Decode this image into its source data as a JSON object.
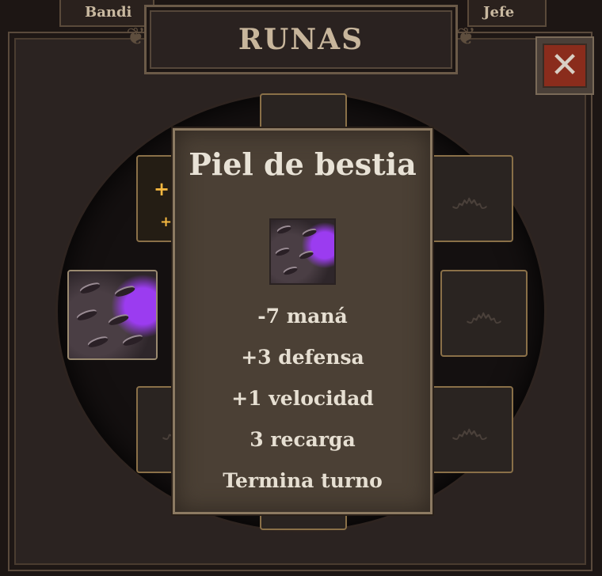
{
  "tabs": {
    "left": "Bandi",
    "right": "Jefe"
  },
  "title": "RUNAS",
  "close_icon": "close-x-icon",
  "slots": {
    "empty_icon": "spiral-rune-icon",
    "equipped_icon": "beast-claw-rune-icon",
    "charged_icon": "sparkle-plus-icon"
  },
  "tooltip": {
    "title": "Piel de bestia",
    "icon": "beast-claw-rune-icon",
    "stats": [
      "-7 maná",
      "+3 defensa",
      "+1 velocidad",
      "3 recarga",
      "Termina turno"
    ]
  },
  "colors": {
    "accent_purple": "#9b3cf0",
    "close_red": "#8a2c1c",
    "spark_gold": "#f5b840",
    "slot_border": "#8a7048"
  }
}
